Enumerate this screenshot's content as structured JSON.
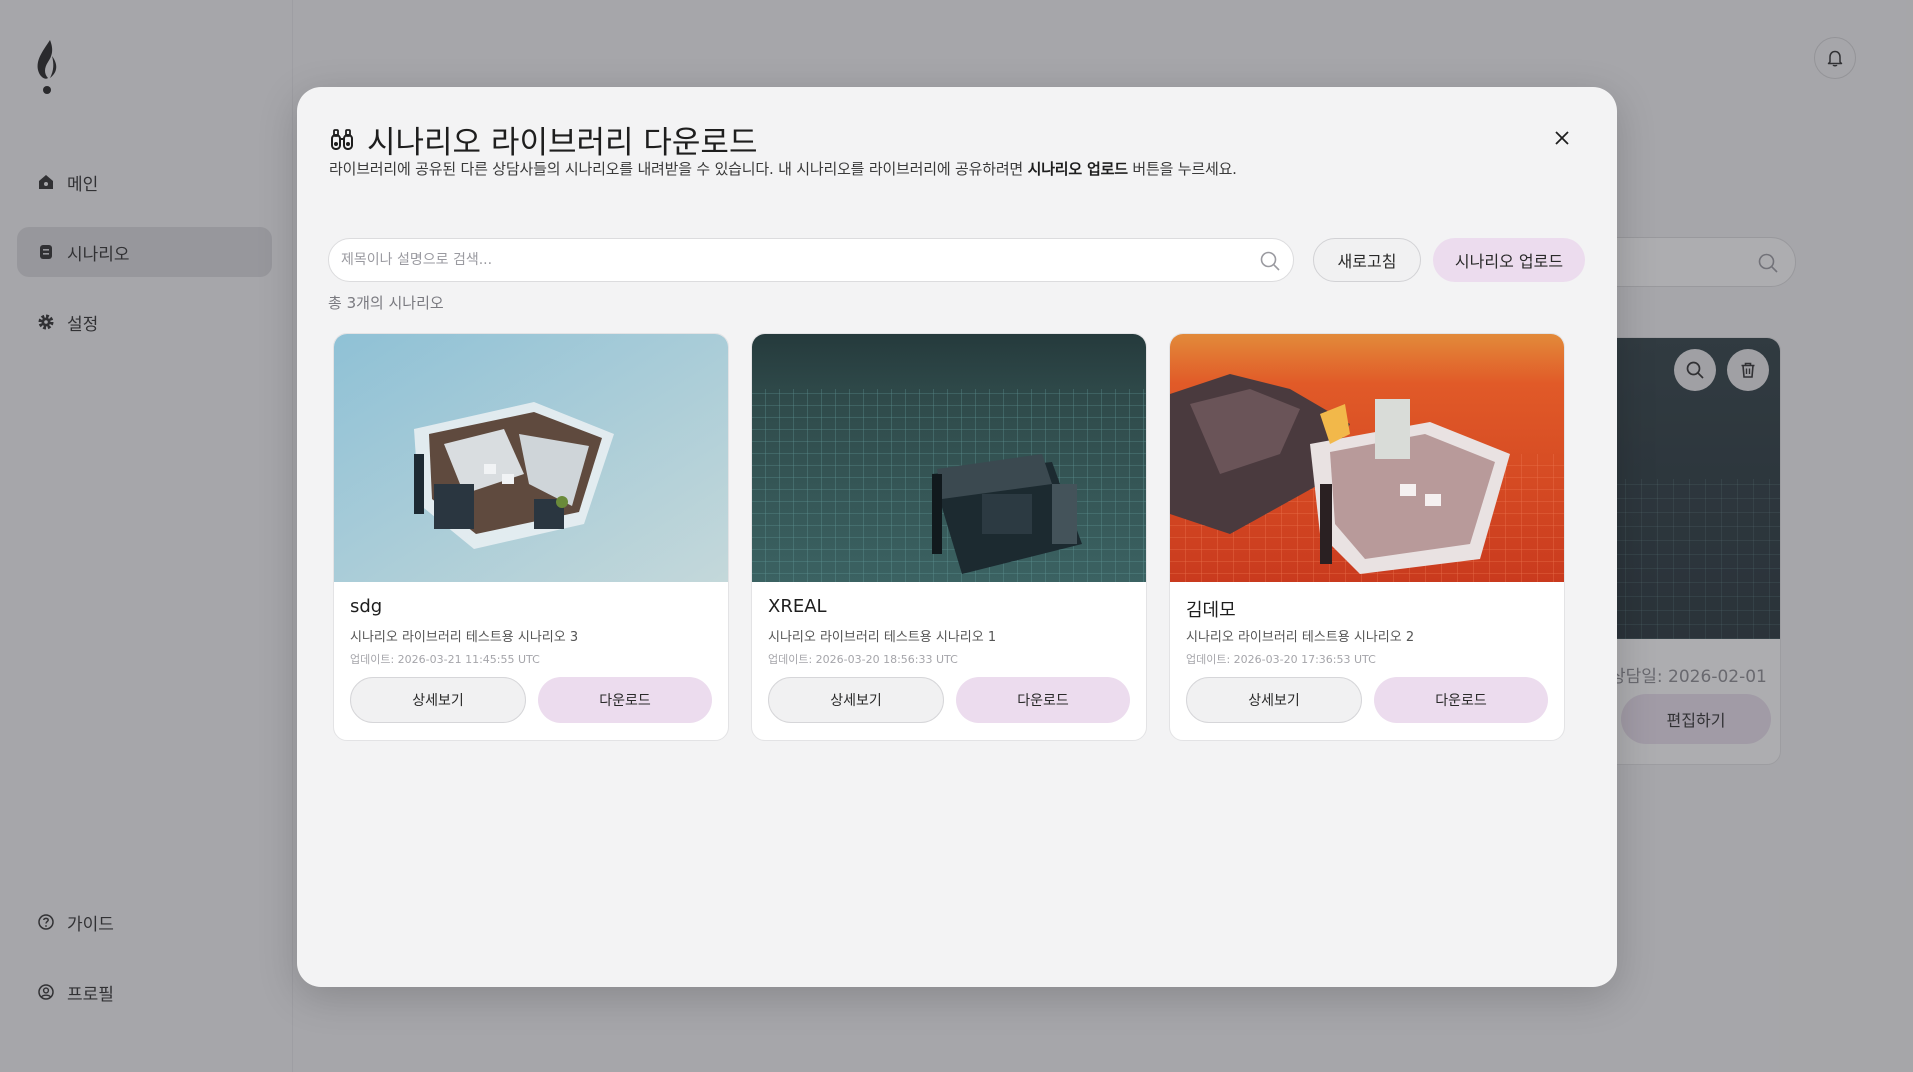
{
  "sidebar": {
    "items": [
      {
        "label": "메인",
        "icon": "home-icon"
      },
      {
        "label": "시나리오",
        "icon": "scenario-icon",
        "active": true
      },
      {
        "label": "설정",
        "icon": "gear-icon"
      }
    ],
    "bottom_items": [
      {
        "label": "가이드",
        "icon": "question-circle-icon"
      },
      {
        "label": "프로필",
        "icon": "user-circle-icon"
      }
    ]
  },
  "background": {
    "card_date": "상담일: 2026-02-01",
    "edit_label": "편집하기"
  },
  "modal": {
    "title": "시나리오 라이브러리 다운로드",
    "desc_prefix": "라이브러리에 공유된 다른 상담사들의 시나리오를 내려받을 수 있습니다. 내 시나리오를 라이브러리에 공유하려면 ",
    "desc_bold": "시나리오 업로드",
    "desc_suffix": " 버튼을 누르세요.",
    "search_placeholder": "제목이나 설명으로 검색...",
    "refresh_label": "새로고침",
    "upload_label": "시나리오 업로드",
    "count_text": "총 3개의 시나리오",
    "cards": [
      {
        "title": "sdg",
        "description": "시나리오 라이브러리 테스트용 시나리오 3",
        "updated": "업데이트: 2026-03-21 11:45:55 UTC",
        "detail_label": "상세보기",
        "download_label": "다운로드"
      },
      {
        "title": "XREAL",
        "description": "시나리오 라이브러리 테스트용 시나리오 1",
        "updated": "업데이트: 2026-03-20 18:56:33 UTC",
        "detail_label": "상세보기",
        "download_label": "다운로드"
      },
      {
        "title": "김데모",
        "description": "시나리오 라이브러리 테스트용 시나리오 2",
        "updated": "업데이트: 2026-03-20 17:36:53 UTC",
        "detail_label": "상세보기",
        "download_label": "다운로드"
      }
    ]
  },
  "colors": {
    "accent_pill": "#ecdcee",
    "active_nav": "#d9d9dc",
    "background": "#f3f3f4"
  }
}
